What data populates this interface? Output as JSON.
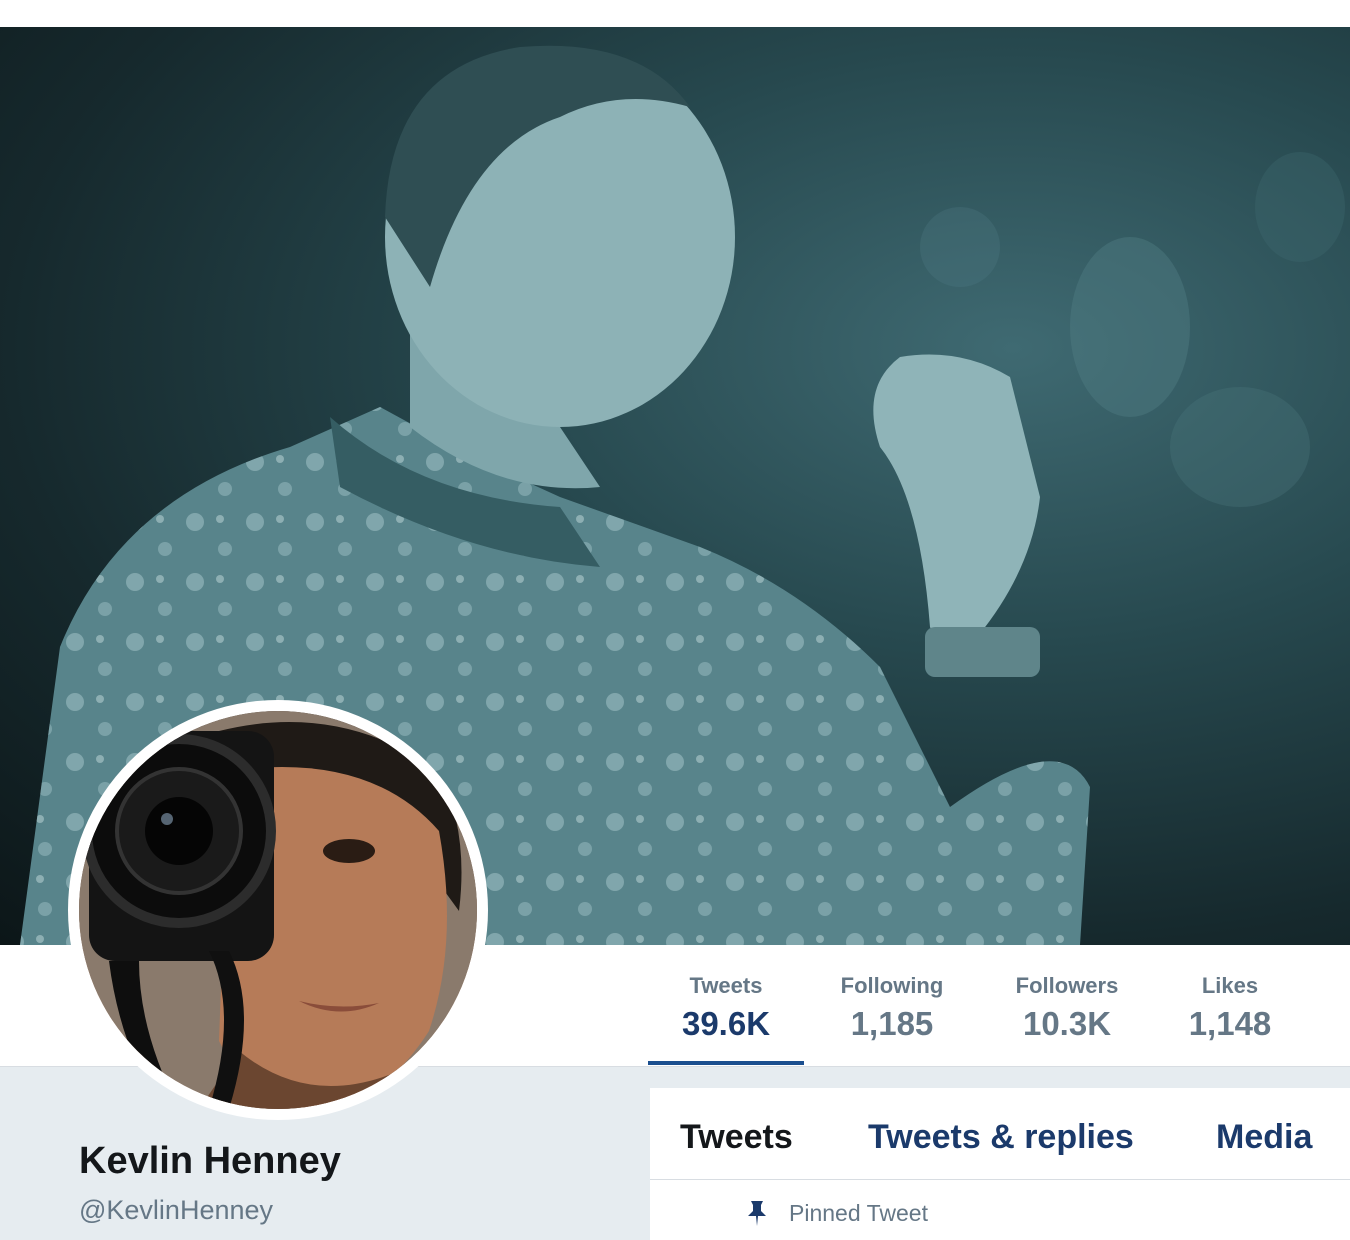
{
  "profile": {
    "name": "Kevlin Henney",
    "handle": "@KevlinHenney"
  },
  "stats": [
    {
      "label": "Tweets",
      "value": "39.6K",
      "active": true
    },
    {
      "label": "Following",
      "value": "1,185",
      "active": false
    },
    {
      "label": "Followers",
      "value": "10.3K",
      "active": false
    },
    {
      "label": "Likes",
      "value": "1,148",
      "active": false
    }
  ],
  "tabs": [
    {
      "label": "Tweets",
      "selected": true
    },
    {
      "label": "Tweets & replies",
      "selected": false
    },
    {
      "label": "Media",
      "selected": false
    }
  ],
  "pinned": {
    "label": "Pinned Tweet",
    "icon": "pin-icon"
  },
  "colors": {
    "accent": "#1b3a6b",
    "muted": "#657786",
    "panel_bg": "#e6ecf0",
    "banner_tint": "#27494f"
  },
  "images": {
    "banner": "header-photo",
    "avatar": "profile-photo"
  }
}
